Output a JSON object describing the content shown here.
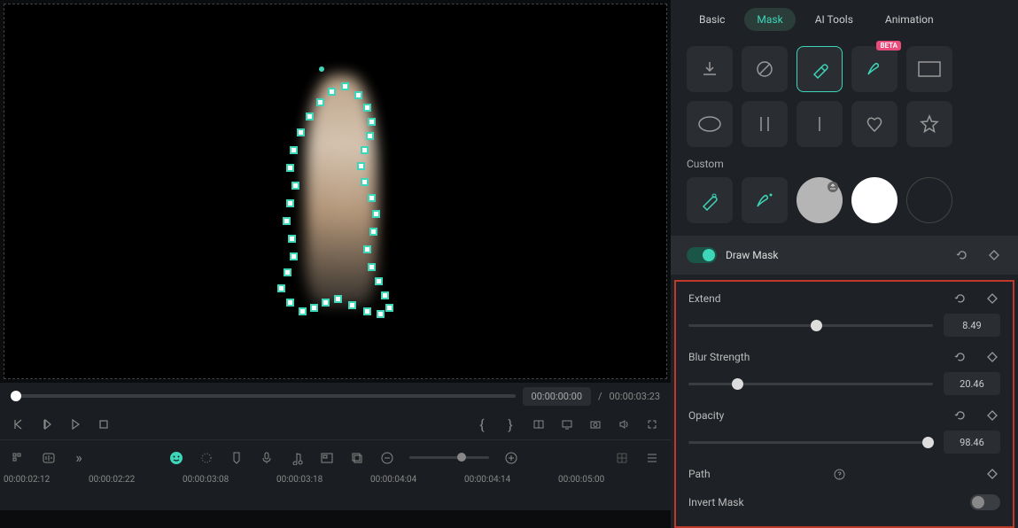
{
  "tabs": [
    "Basic",
    "Mask",
    "AI Tools",
    "Animation"
  ],
  "active_tab": 1,
  "shapes_beta_label": "BETA",
  "custom_label": "Custom",
  "draw_mask": {
    "label": "Draw Mask",
    "enabled": true
  },
  "props": {
    "extend": {
      "label": "Extend",
      "value": 8.49,
      "min": -50,
      "max": 50,
      "pos": 52
    },
    "blur": {
      "label": "Blur Strength",
      "value": 20.46,
      "min": 0,
      "max": 100,
      "pos": 20
    },
    "opacity": {
      "label": "Opacity",
      "value": 98.46,
      "min": 0,
      "max": 100,
      "pos": 98
    }
  },
  "path_label": "Path",
  "invert_label": "Invert Mask",
  "invert_enabled": false,
  "transport": {
    "current": "00:00:00:00",
    "separator": "/",
    "total": "00:00:03:23"
  },
  "ruler_ticks": [
    "00:00:02:12",
    "00:00:02:22",
    "00:00:03:08",
    "00:00:03:18",
    "00:00:04:04",
    "00:00:04:14",
    "00:00:05:00"
  ]
}
